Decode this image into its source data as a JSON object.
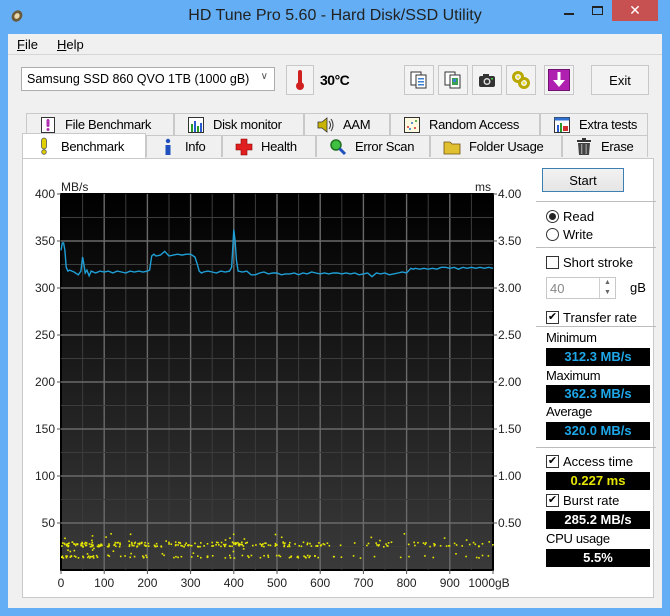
{
  "window": {
    "title": "HD Tune Pro 5.60 - Hard Disk/SSD Utility",
    "controls": {
      "minimize": "—",
      "maximize": "☐",
      "close": "✕"
    }
  },
  "menu": [
    {
      "label": "File",
      "accel": "F",
      "rest": "ile"
    },
    {
      "label": "Help",
      "accel": "H",
      "rest": "elp"
    }
  ],
  "toolbar": {
    "drive": "Samsung SSD 860 QVO 1TB (1000 gB)",
    "temperature": "30°C",
    "icons": [
      "copy-text-icon",
      "copy-screenshot-icon",
      "camera-icon",
      "options-icon",
      "save-down-icon"
    ],
    "exit_label": "Exit"
  },
  "tabs_top": [
    {
      "label": "File Benchmark",
      "icon": "file-benchmark-icon"
    },
    {
      "label": "Disk monitor",
      "icon": "disk-monitor-icon"
    },
    {
      "label": "AAM",
      "icon": "speaker-icon"
    },
    {
      "label": "Random Access",
      "icon": "random-access-icon"
    },
    {
      "label": "Extra tests",
      "icon": "extra-tests-icon"
    }
  ],
  "tabs_bottom": [
    {
      "label": "Benchmark",
      "icon": "exclamation-icon",
      "active": true
    },
    {
      "label": "Info",
      "icon": "info-icon"
    },
    {
      "label": "Health",
      "icon": "health-cross-icon"
    },
    {
      "label": "Error Scan",
      "icon": "magnifier-icon"
    },
    {
      "label": "Folder Usage",
      "icon": "folder-icon"
    },
    {
      "label": "Erase",
      "icon": "trash-icon"
    }
  ],
  "side": {
    "start_label": "Start",
    "read_label": "Read",
    "write_label": "Write",
    "mode": "Read",
    "short_stroke_label": "Short stroke",
    "short_stroke_checked": false,
    "short_stroke_value": "40",
    "short_stroke_unit": "gB",
    "transfer_rate_label": "Transfer rate",
    "transfer_rate_checked": true,
    "minimum_label": "Minimum",
    "minimum_value": "312.3 MB/s",
    "maximum_label": "Maximum",
    "maximum_value": "362.3 MB/s",
    "average_label": "Average",
    "average_value": "320.0 MB/s",
    "access_time_label": "Access time",
    "access_time_checked": true,
    "access_time_value": "0.227 ms",
    "burst_rate_label": "Burst rate",
    "burst_rate_checked": true,
    "burst_rate_value": "285.2 MB/s",
    "cpu_usage_label": "CPU usage",
    "cpu_usage_value": "5.5%"
  },
  "colors": {
    "transfer_line": "#1f9fd6",
    "access_dots": "#e8e800",
    "readout_blue": "#1ea7e8",
    "readout_yellow": "#e6e600",
    "close_button": "#c75050",
    "window_frame": "#63aef4"
  },
  "chart_data": {
    "type": "line",
    "title": "",
    "xlabel": "gB",
    "ylabel_left": "MB/s",
    "ylabel_right": "ms",
    "xlim": [
      0,
      1000
    ],
    "ylim_left": [
      0,
      400
    ],
    "ylim_right": [
      0,
      4.0
    ],
    "x_ticks": [
      "0",
      "100",
      "200",
      "300",
      "400",
      "500",
      "600",
      "700",
      "800",
      "900",
      "1000gB"
    ],
    "y_ticks_left": [
      "50",
      "100",
      "150",
      "200",
      "250",
      "300",
      "350",
      "400"
    ],
    "y_ticks_right": [
      "0.50",
      "1.00",
      "1.50",
      "2.00",
      "2.50",
      "3.00",
      "3.50",
      "4.00"
    ],
    "grid": true,
    "series": [
      {
        "name": "Transfer rate",
        "unit": "MB/s",
        "x": [
          0,
          3,
          6,
          9,
          12,
          16,
          20,
          30,
          40,
          46,
          50,
          53,
          56,
          60,
          65,
          70,
          80,
          90,
          100,
          110,
          120,
          130,
          140,
          150,
          160,
          170,
          180,
          190,
          200,
          205,
          210,
          215,
          220,
          230,
          240,
          250,
          260,
          270,
          280,
          290,
          300,
          310,
          315,
          320,
          325,
          330,
          340,
          350,
          360,
          370,
          380,
          390,
          395,
          398,
          400,
          403,
          406,
          410,
          420,
          430,
          440,
          450,
          460,
          470,
          480,
          490,
          500,
          510,
          520,
          530,
          540,
          550,
          560,
          570,
          580,
          590,
          600,
          610,
          620,
          630,
          640,
          650,
          660,
          670,
          680,
          690,
          700,
          710,
          720,
          730,
          740,
          750,
          760,
          770,
          780,
          790,
          800,
          810,
          815,
          820,
          830,
          840,
          850,
          860,
          870,
          880,
          890,
          900,
          910,
          920,
          930,
          940,
          950,
          960,
          970,
          980,
          990,
          1000
        ],
        "values": [
          340,
          348,
          348,
          340,
          322,
          318,
          319,
          317,
          314,
          318,
          333,
          325,
          316,
          319,
          313,
          318,
          316,
          318,
          317,
          318,
          316,
          318,
          317,
          316,
          318,
          317,
          318,
          317,
          318,
          319,
          334,
          336,
          334,
          335,
          339,
          334,
          335,
          336,
          335,
          336,
          336,
          333,
          326,
          318,
          316,
          317,
          318,
          317,
          316,
          318,
          317,
          318,
          322,
          345,
          362,
          350,
          330,
          318,
          317,
          318,
          314,
          314,
          316,
          317,
          315,
          316,
          316,
          314,
          315,
          315,
          316,
          314,
          316,
          315,
          317,
          316,
          315,
          316,
          315,
          316,
          316,
          315,
          316,
          315,
          316,
          314,
          315,
          316,
          312,
          316,
          315,
          316,
          314,
          315,
          316,
          317,
          316,
          321,
          320,
          321,
          320,
          321,
          320,
          321,
          320,
          322,
          322,
          321,
          322,
          320,
          322,
          321,
          322,
          321,
          322,
          321,
          322,
          321
        ]
      },
      {
        "name": "Access time",
        "unit": "ms",
        "type": "scatter",
        "description": "yellow dots concentrated at ~0.28 ms (main band) and ~0.15 ms (lower band), sparse outliers up to ~0.40 ms, denser from 0-600 gB and sparser towards 1000 gB",
        "band_main_ms": 0.28,
        "band_low_ms": 0.15,
        "max_ms": 0.4,
        "average_ms": 0.227
      }
    ]
  }
}
